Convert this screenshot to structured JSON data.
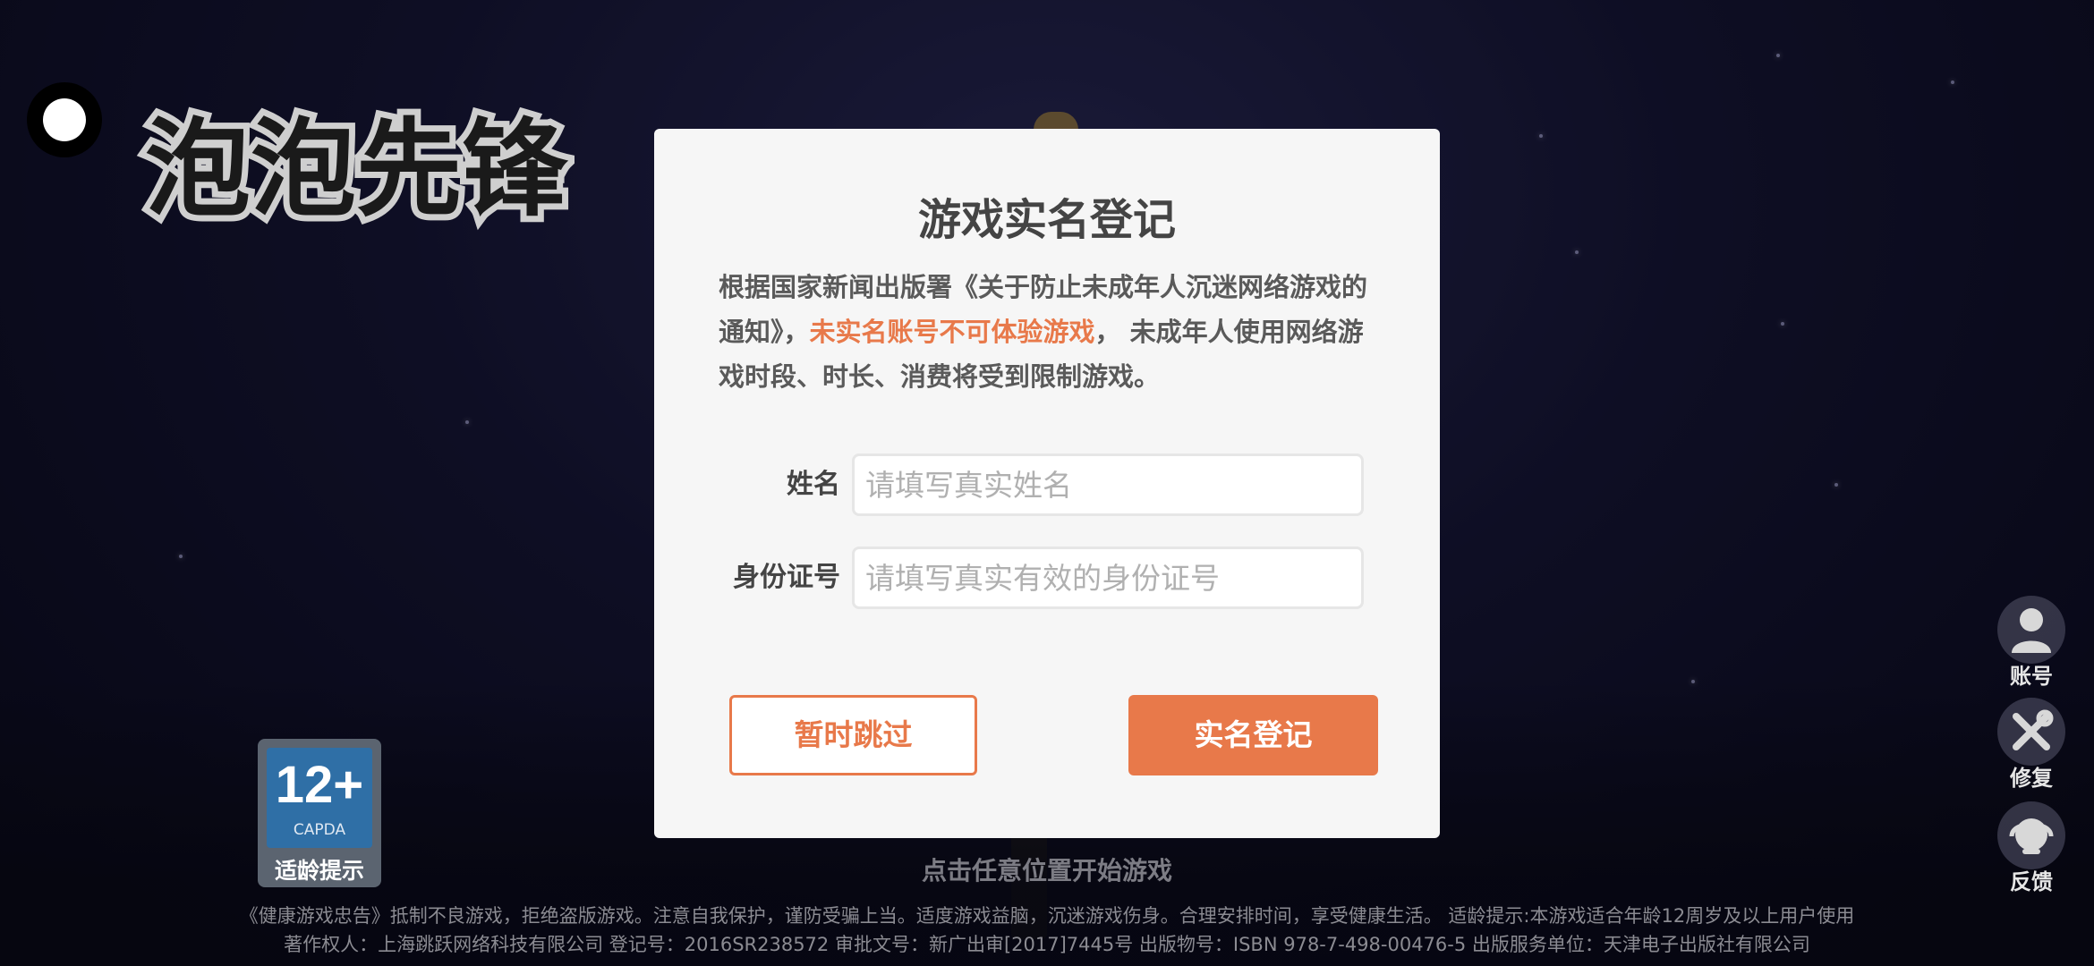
{
  "game": {
    "logo_text": "泡泡先锋",
    "start_hint": "点击任意位置开始游戏"
  },
  "age_rating": {
    "rating": "12+",
    "org": "CAPDA",
    "label": "适龄提示"
  },
  "side_menu": {
    "account": "账号",
    "repair": "修复",
    "feedback": "反馈"
  },
  "dialog": {
    "title": "游戏实名登记",
    "desc_part1": "根据国家新闻出版署《关于防止未成年人沉迷网络游戏的通知》，",
    "desc_highlight": "未实名账号不可体验游戏",
    "desc_part2": "， 未成年人使用网络游戏时段、时长、消费将受到限制游戏。",
    "name_label": "姓名",
    "name_placeholder": "请填写真实姓名",
    "name_value": "",
    "id_label": "身份证号",
    "id_placeholder": "请填写真实有效的身份证号",
    "id_value": "",
    "skip_label": "暂时跳过",
    "register_label": "实名登记"
  },
  "footer": {
    "line1": "《健康游戏忠告》抵制不良游戏，拒绝盗版游戏。注意自我保护，谨防受骗上当。适度游戏益脑，沉迷游戏伤身。合理安排时间，享受健康生活。 适龄提示:本游戏适合年龄12周岁及以上用户使用",
    "line2": "著作权人：上海跳跃网络科技有限公司 登记号：2016SR238572 审批文号：新广出审[2017]7445号 出版物号：ISBN 978-7-498-00476-5 出版服务单位：天津电子出版社有限公司"
  },
  "colors": {
    "accent": "#e8794a",
    "dialog_bg": "#f6f6f6"
  }
}
